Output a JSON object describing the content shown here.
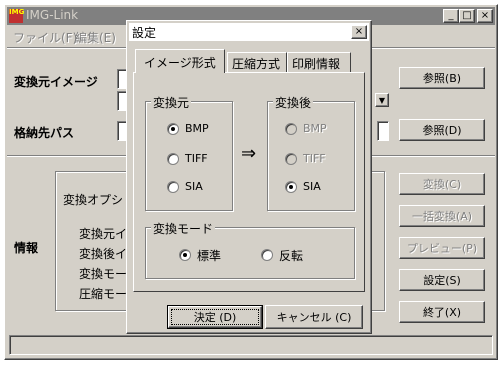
{
  "app": {
    "title": "IMG-Link",
    "menu": [
      "ファイル(F)",
      "編集(E)"
    ],
    "labels": {
      "source_image": "変換元イメージ",
      "dest_path": "格納先パス",
      "info": "情報",
      "convert_options": "変換オプシ"
    },
    "info_rows": [
      "変換元イ",
      "変換後イ",
      "変換モー",
      "圧縮モー"
    ],
    "buttons": {
      "browse1": "参照(B)",
      "browse2": "参照(D)",
      "convert": "変換(C)",
      "batch_convert": "一括変換(A)",
      "preview": "プレビュー(P)",
      "settings": "設定(S)",
      "exit": "終了(X)"
    },
    "window_controls": [
      "_",
      "□",
      "×"
    ]
  },
  "dialog": {
    "title": "設定",
    "close": "×",
    "tabs": [
      "イメージ形式",
      "圧縮方式",
      "印刷情報"
    ],
    "source_group": {
      "title": "変換元",
      "options": [
        "BMP",
        "TIFF",
        "SIA"
      ],
      "selected": "BMP"
    },
    "arrow": "⇒",
    "target_group": {
      "title": "変換後",
      "options": [
        "BMP",
        "TIFF",
        "SIA"
      ],
      "selected": "SIA"
    },
    "mode_group": {
      "title": "変換モード",
      "options": [
        "標準",
        "反転"
      ],
      "selected": "標準"
    },
    "ok_label": "決定 (D)",
    "cancel_label": "キャンセル (C)"
  },
  "colors": {
    "face": "#d4d0c8",
    "dialog_title": "#ffffff",
    "main_title": "#808080"
  }
}
